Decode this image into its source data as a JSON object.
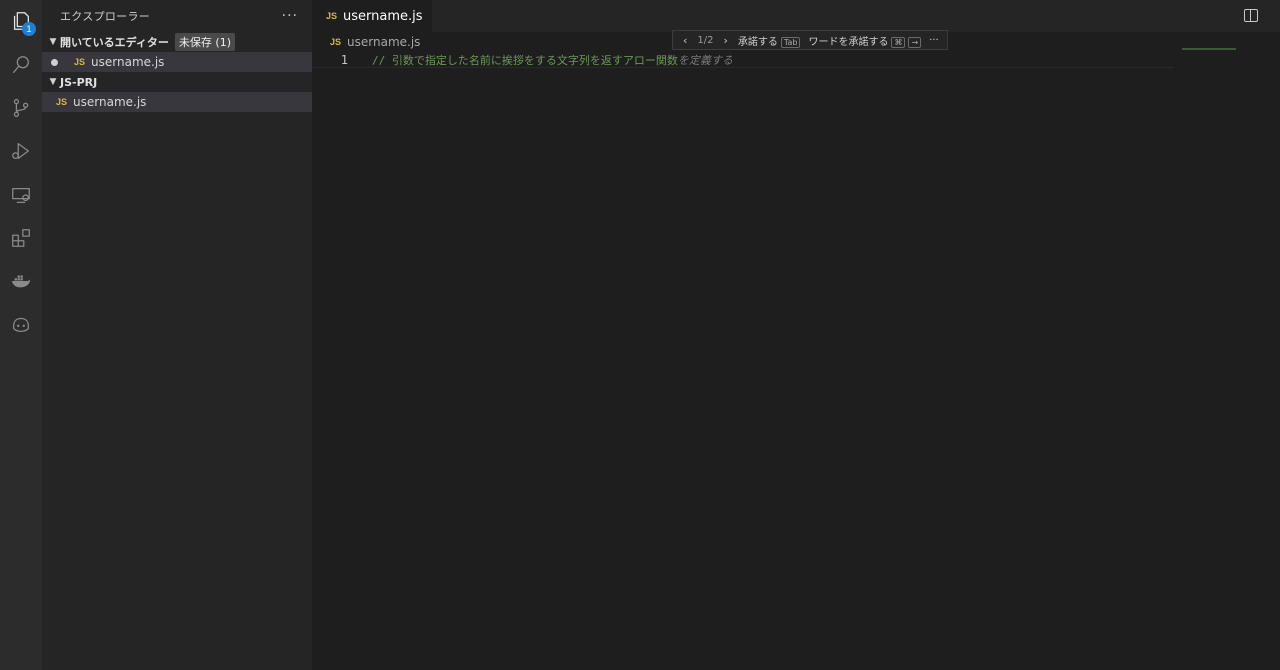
{
  "activity_bar": {
    "explorer_badge": "1",
    "icons": [
      "files-icon",
      "search-icon",
      "source-control-icon",
      "run-debug-icon",
      "remote-explorer-icon",
      "extensions-icon",
      "docker-icon",
      "copilot-icon"
    ]
  },
  "sidebar": {
    "title": "エクスプローラー",
    "more": "···",
    "open_editors": {
      "label": "開いているエディター",
      "unsaved_badge": "未保存 (1)",
      "files": [
        {
          "name": "username.js",
          "type_badge": "JS"
        }
      ]
    },
    "project": {
      "label": "JS-PRJ",
      "files": [
        {
          "name": "username.js",
          "type_badge": "JS"
        }
      ]
    }
  },
  "editor": {
    "tab": {
      "label": "username.js",
      "type_badge": "JS"
    },
    "breadcrumb": {
      "file": "username.js",
      "type_badge": "JS"
    },
    "lines": [
      {
        "number": "1",
        "code": "// 引数で指定した名前に挨拶をする文字列を返すアロー関数",
        "ghost": "を定義する"
      }
    ],
    "suggestion_toolbar": {
      "prev": "‹",
      "counter": "1/2",
      "next": "›",
      "accept_label": "承諾する",
      "accept_key": "Tab",
      "accept_word_label": "ワードを承諾する",
      "accept_word_key1": "⌘",
      "accept_word_key2": "→",
      "more": "···"
    }
  },
  "colors": {
    "activity_bar": "#2c2c2c",
    "sidebar": "#252526",
    "editor": "#1e1e1e",
    "comment": "#6a9955",
    "js_badge": "#d7ba3d",
    "badge_blue": "#1f7fd4"
  }
}
